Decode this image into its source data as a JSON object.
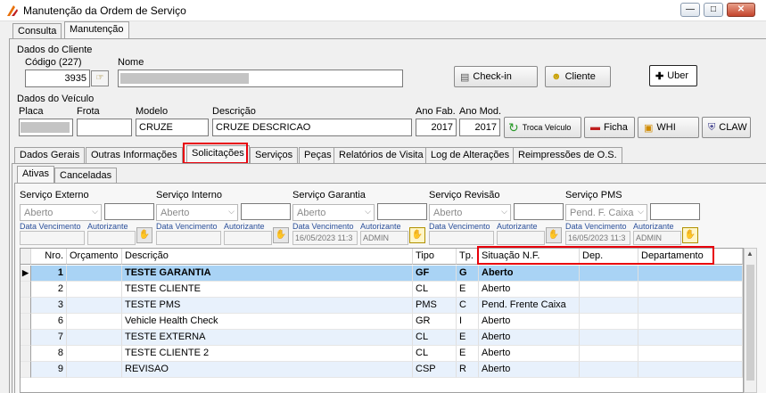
{
  "window": {
    "title": "Manutenção da Ordem de Serviço"
  },
  "main_tabs": [
    "Consulta",
    "Manutenção"
  ],
  "cliente": {
    "section": "Dados do Cliente",
    "codigo_label": "Código (227)",
    "codigo_value": "3935",
    "nome_label": "Nome",
    "nome_value": "",
    "checkin_label": "Check-in",
    "cliente_label": "Cliente",
    "uber_label": "Uber"
  },
  "veiculo": {
    "section": "Dados do Veículo",
    "placa_label": "Placa",
    "frota_label": "Frota",
    "modelo_label": "Modelo",
    "modelo_value": "CRUZE",
    "descricao_label": "Descrição",
    "descricao_value": "CRUZE DESCRICAO",
    "anofab_label": "Ano Fab.",
    "anofab_value": "2017",
    "anomod_label": "Ano Mod.",
    "anomod_value": "2017",
    "troca_label": "Troca Veículo",
    "ficha_label": "Ficha",
    "whi_label": "WHI",
    "claw_label": "CLAW"
  },
  "section_tabs": [
    "Dados Gerais",
    "Outras Informações",
    "Solicitações",
    "Serviços",
    "Peças",
    "Relatórios de Visita",
    "Log de Alterações",
    "Reimpressões de O.S."
  ],
  "sub_tabs": [
    "Ativas",
    "Canceladas"
  ],
  "servicos": [
    {
      "label": "Serviço Externo",
      "status": "Aberto",
      "extra": "",
      "date_label": "Data Vencimento",
      "auth_label": "Autorizante",
      "date": "",
      "user": ""
    },
    {
      "label": "Serviço Interno",
      "status": "Aberto",
      "extra": "",
      "date_label": "Data Vencimento",
      "auth_label": "Autorizante",
      "date": "",
      "user": ""
    },
    {
      "label": "Serviço Garantia",
      "status": "Aberto",
      "extra": "",
      "date_label": "Data Vencimento",
      "auth_label": "Autorizante",
      "date": "16/05/2023 11:3",
      "user": "ADMIN"
    },
    {
      "label": "Serviço Revisão",
      "status": "Aberto",
      "extra": "",
      "date_label": "Data Vencimento",
      "auth_label": "Autorizante",
      "date": "",
      "user": ""
    },
    {
      "label": "Serviço PMS",
      "status": "Pend. F. Caixa",
      "extra": "",
      "date_label": "Data Vencimento",
      "auth_label": "Autorizante",
      "date": "16/05/2023 11:3",
      "user": "ADMIN"
    }
  ],
  "grid": {
    "columns": [
      "Nro.",
      "Orçamento",
      "Descrição",
      "Tipo",
      "Tp.",
      "Situação N.F.",
      "Dep.",
      "Departamento"
    ],
    "rows": [
      {
        "nro": "1",
        "orc": "",
        "desc": "TESTE GARANTIA",
        "tipo": "GF",
        "tp": "G",
        "sit": "Aberto",
        "dep": "",
        "depto": ""
      },
      {
        "nro": "2",
        "orc": "",
        "desc": "TESTE CLIENTE",
        "tipo": "CL",
        "tp": "E",
        "sit": "Aberto",
        "dep": "",
        "depto": ""
      },
      {
        "nro": "3",
        "orc": "",
        "desc": "TESTE PMS",
        "tipo": "PMS",
        "tp": "C",
        "sit": "Pend. Frente Caixa",
        "dep": "",
        "depto": ""
      },
      {
        "nro": "6",
        "orc": "",
        "desc": "Vehicle Health Check",
        "tipo": "GR",
        "tp": "I",
        "sit": "Aberto",
        "dep": "",
        "depto": ""
      },
      {
        "nro": "7",
        "orc": "",
        "desc": "TESTE EXTERNA",
        "tipo": "CL",
        "tp": "E",
        "sit": "Aberto",
        "dep": "",
        "depto": ""
      },
      {
        "nro": "8",
        "orc": "",
        "desc": "TESTE CLIENTE 2",
        "tipo": "CL",
        "tp": "E",
        "sit": "Aberto",
        "dep": "",
        "depto": ""
      },
      {
        "nro": "9",
        "orc": "",
        "desc": "REVISAO",
        "tipo": "CSP",
        "tp": "R",
        "sit": "Aberto",
        "dep": "",
        "depto": ""
      }
    ]
  },
  "colors": {
    "selected_row": "#a9d3f5",
    "alt_row": "#e8f1fc",
    "highlight": "#e8000b"
  }
}
